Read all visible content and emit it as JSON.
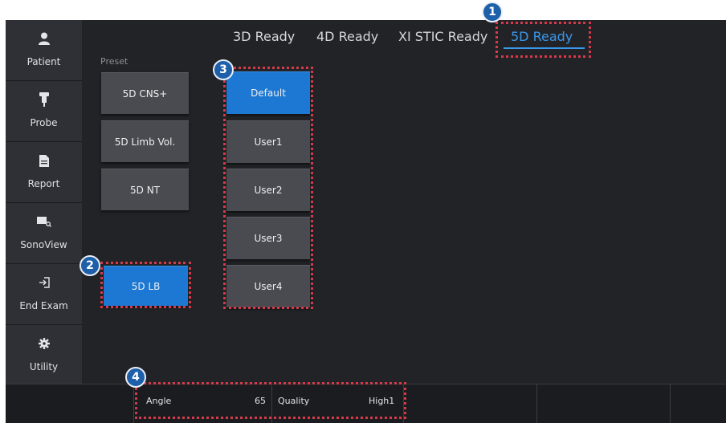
{
  "sidebar": {
    "items": [
      {
        "label": "Patient",
        "icon": "person-icon"
      },
      {
        "label": "Probe",
        "icon": "probe-icon"
      },
      {
        "label": "Report",
        "icon": "document-icon"
      },
      {
        "label": "SonoView",
        "icon": "image-search-icon"
      },
      {
        "label": "End Exam",
        "icon": "exit-icon"
      },
      {
        "label": "Utility",
        "icon": "gear-icon"
      }
    ]
  },
  "tabs": [
    "3D Ready",
    "4D Ready",
    "XI STIC Ready",
    "5D Ready"
  ],
  "active_tab": "5D Ready",
  "preset": {
    "label": "Preset",
    "buttons": [
      "5D CNS+",
      "5D Limb Vol.",
      "5D NT"
    ],
    "selected": "5D LB"
  },
  "user_presets": [
    "Default",
    "User1",
    "User2",
    "User3",
    "User4"
  ],
  "selected_user_preset": "Default",
  "bottom": {
    "angle_label": "Angle",
    "angle_value": "65",
    "quality_label": "Quality",
    "quality_value": "High1"
  },
  "badges": [
    "1",
    "2",
    "3",
    "4"
  ],
  "colors": {
    "accent": "#1d78d3",
    "highlight": "#d43a4a",
    "active_tab": "#3a97ea"
  }
}
